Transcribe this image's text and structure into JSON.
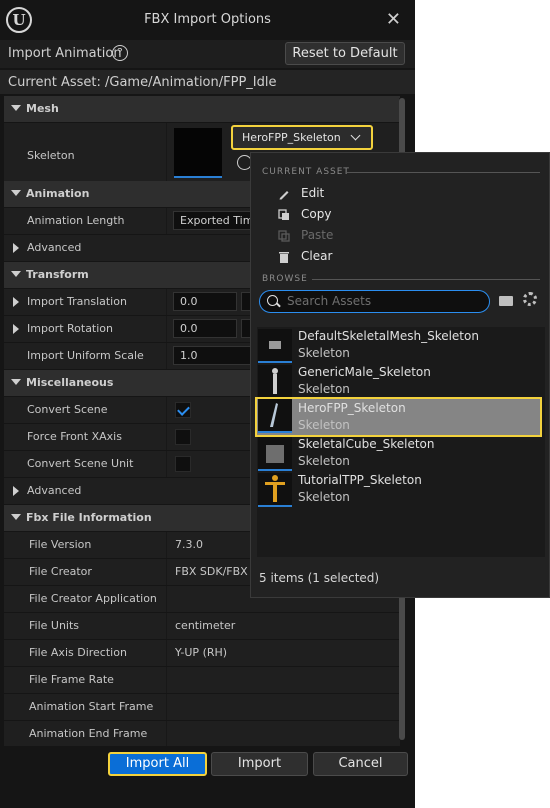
{
  "window": {
    "title": "FBX Import Options"
  },
  "toolbar": {
    "label": "Import Animation",
    "reset_label": "Reset to Default"
  },
  "asset": {
    "current": "Current Asset:  /Game/Animation/FPP_Idle"
  },
  "sections": {
    "mesh": "Mesh",
    "skeleton_label": "Skeleton",
    "skeleton_value": "HeroFPP_Skeleton",
    "animation": "Animation",
    "animation_length": "Animation Length",
    "animation_length_value": "Exported Time",
    "advanced1": "Advanced",
    "transform": "Transform",
    "import_translation": "Import Translation",
    "import_translation_value": "0.0",
    "import_rotation": "Import Rotation",
    "import_rotation_value": "0.0",
    "import_uniform_scale": "Import Uniform Scale",
    "import_uniform_scale_value": "1.0",
    "misc": "Miscellaneous",
    "convert_scene": "Convert Scene",
    "force_front_xaxis": "Force Front XAxis",
    "convert_scene_unit": "Convert Scene Unit",
    "advanced2": "Advanced",
    "fbx_info": "Fbx File Information"
  },
  "fbx_info": [
    {
      "label": "File Version",
      "value": "7.3.0"
    },
    {
      "label": "File Creator",
      "value": "FBX SDK/FBX P"
    },
    {
      "label": "File Creator Application",
      "value": ""
    },
    {
      "label": "File Units",
      "value": "centimeter"
    },
    {
      "label": "File Axis Direction",
      "value": "Y-UP (RH)"
    },
    {
      "label": "File Frame Rate",
      "value": ""
    },
    {
      "label": "Animation Start Frame",
      "value": ""
    },
    {
      "label": "Animation End Frame",
      "value": ""
    }
  ],
  "buttons": {
    "import_all": "Import All",
    "import": "Import",
    "cancel": "Cancel"
  },
  "popup": {
    "current_asset_heading": "CURRENT ASSET",
    "edit": "Edit",
    "copy": "Copy",
    "paste": "Paste",
    "clear": "Clear",
    "browse_heading": "BROWSE",
    "search_placeholder": "Search Assets",
    "items": [
      {
        "name": "DefaultSkeletalMesh_Skeleton",
        "type": "Skeleton"
      },
      {
        "name": "GenericMale_Skeleton",
        "type": "Skeleton"
      },
      {
        "name": "HeroFPP_Skeleton",
        "type": "Skeleton"
      },
      {
        "name": "SkeletalCube_Skeleton",
        "type": "Skeleton"
      },
      {
        "name": "TutorialTPP_Skeleton",
        "type": "Skeleton"
      }
    ],
    "status": "5 items (1 selected)"
  },
  "colors": {
    "accent": "#2b8ef0",
    "highlight": "#f3d23d",
    "primary_button": "#0a6ed7"
  }
}
